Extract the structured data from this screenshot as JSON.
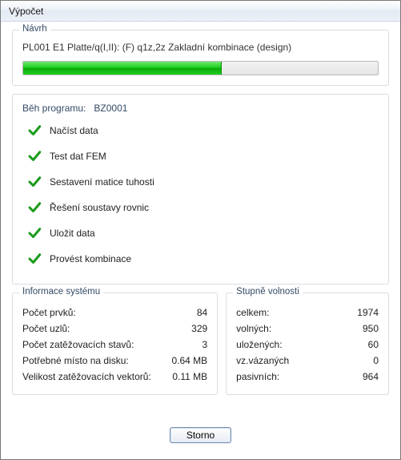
{
  "window": {
    "title": "Výpočet"
  },
  "design": {
    "group_title": "Návrh",
    "line": "PL001 E1 Platte/q(I,II): (F) q1z,2z Zakladní kombinace (design)",
    "progress_pct": 56
  },
  "run": {
    "title_prefix": "Běh programu:",
    "program": "BZ0001",
    "steps": [
      "Načíst data",
      "Test dat FEM",
      "Sestavení matice tuhosti",
      "Řešení soustavy rovnic",
      "Uložit data",
      "Provést kombinace"
    ]
  },
  "sysinfo": {
    "group_title": "Informace systému",
    "rows": [
      {
        "k": "Počet prvků:",
        "v": "84"
      },
      {
        "k": "Počet uzlů:",
        "v": "329"
      },
      {
        "k": "Počet zatěžovacích stavů:",
        "v": "3"
      },
      {
        "k": "Potřebné místo na disku:",
        "v": "0.64 MB"
      },
      {
        "k": "Velikost zatěžovacích vektorů:",
        "v": "0.11 MB"
      }
    ]
  },
  "dof": {
    "group_title": "Stupně volnosti",
    "rows": [
      {
        "k": "celkem:",
        "v": "1974"
      },
      {
        "k": "volných:",
        "v": "950"
      },
      {
        "k": "uložených:",
        "v": "60"
      },
      {
        "k": "vz.vázaných",
        "v": "0"
      },
      {
        "k": "pasivních:",
        "v": "964"
      }
    ]
  },
  "footer": {
    "cancel_label": "Storno"
  }
}
